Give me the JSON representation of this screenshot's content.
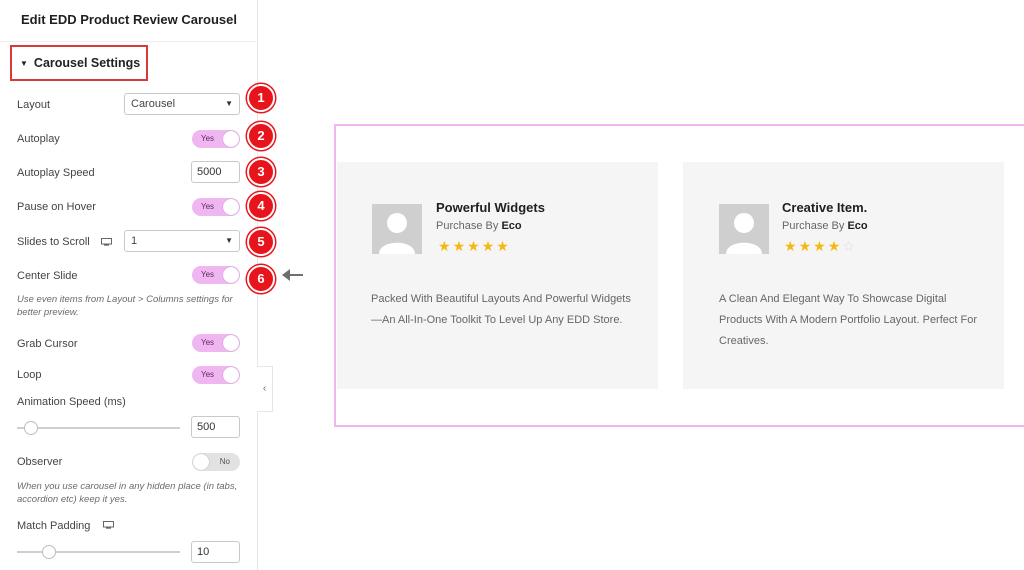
{
  "panel": {
    "title": "Edit EDD Product Review Carousel",
    "section_label": "Carousel Settings",
    "layout": {
      "label": "Layout",
      "value": "Carousel"
    },
    "autoplay": {
      "label": "Autoplay",
      "toggle": "Yes"
    },
    "autoplay_speed": {
      "label": "Autoplay Speed",
      "value": "5000"
    },
    "pause_on_hover": {
      "label": "Pause on Hover",
      "toggle": "Yes"
    },
    "slides_to_scroll": {
      "label": "Slides to Scroll",
      "value": "1"
    },
    "center_slide": {
      "label": "Center Slide",
      "toggle": "Yes",
      "note": "Use even items from Layout > Columns settings for better preview."
    },
    "grab_cursor": {
      "label": "Grab Cursor",
      "toggle": "Yes"
    },
    "loop": {
      "label": "Loop",
      "toggle": "Yes"
    },
    "animation_speed": {
      "label": "Animation Speed (ms)",
      "value": "500"
    },
    "observer": {
      "label": "Observer",
      "toggle": "No",
      "note": "When you use carousel in any hidden place (in tabs, accordion etc) keep it yes."
    },
    "match_padding": {
      "label": "Match Padding",
      "value": "10"
    }
  },
  "badges": [
    "1",
    "2",
    "3",
    "4",
    "5",
    "6"
  ],
  "cards": [
    {
      "title": "Powerful Widgets",
      "by_prefix": "Purchase By",
      "by_name": "Eco",
      "rating": 5,
      "description": "Packed With Beautiful Layouts And Powerful Widgets—An All-In-One Toolkit To Level Up Any EDD Store."
    },
    {
      "title": "Creative Item.",
      "by_prefix": "Purchase By",
      "by_name": "Eco",
      "rating": 4,
      "description": "A Clean And Elegant Way To Showcase Digital Products With A Modern Portfolio Layout. Perfect For Creatives."
    }
  ],
  "colors": {
    "badge": "#e8141b",
    "toggle_on": "#f0b6f2",
    "highlight_border": "#d83a3a",
    "preview_border": "#efb6f0",
    "star": "#f5b80f"
  }
}
